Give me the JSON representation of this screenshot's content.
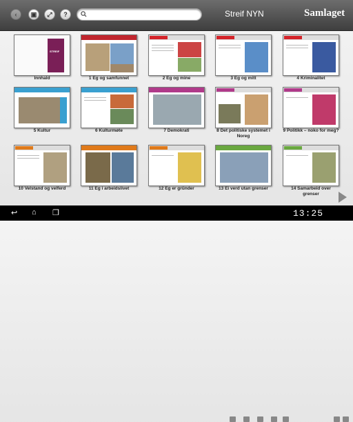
{
  "header": {
    "title": "Streif NYN",
    "brand": "Samlaget",
    "search_placeholder": ""
  },
  "toolbar": {
    "icons": [
      "back-icon",
      "bookmark-icon",
      "expand-icon",
      "help-icon"
    ]
  },
  "tiles": [
    {
      "label": "Innhald",
      "color": "#ffffff"
    },
    {
      "label": "1 Eg og samfunnet",
      "color": "#c0262e"
    },
    {
      "label": "2 Eg og mine",
      "color": "#c0262e"
    },
    {
      "label": "3 Eg og mitt",
      "color": "#c0262e"
    },
    {
      "label": "4 Kriminalitet",
      "color": "#c0262e"
    },
    {
      "label": "5 Kultur",
      "color": "#3aa0d0"
    },
    {
      "label": "6 Kulturmøte",
      "color": "#3aa0d0"
    },
    {
      "label": "7 Demokrati",
      "color": "#b03a8a"
    },
    {
      "label": "8 Det politiske systemet i Noreg",
      "color": "#b03a8a"
    },
    {
      "label": "9 Politikk – noko for meg?",
      "color": "#b03a8a"
    },
    {
      "label": "10 Velstand og velferd",
      "color": "#e07a1a"
    },
    {
      "label": "11 Eg i arbeidslivet",
      "color": "#e07a1a"
    },
    {
      "label": "12 Eg er gründer",
      "color": "#e07a1a"
    },
    {
      "label": "13 Ei verd utan grenser",
      "color": "#6aa840"
    },
    {
      "label": "14 Samarbeid over grenser",
      "color": "#6aa840"
    }
  ],
  "status": {
    "time": "13:25"
  }
}
